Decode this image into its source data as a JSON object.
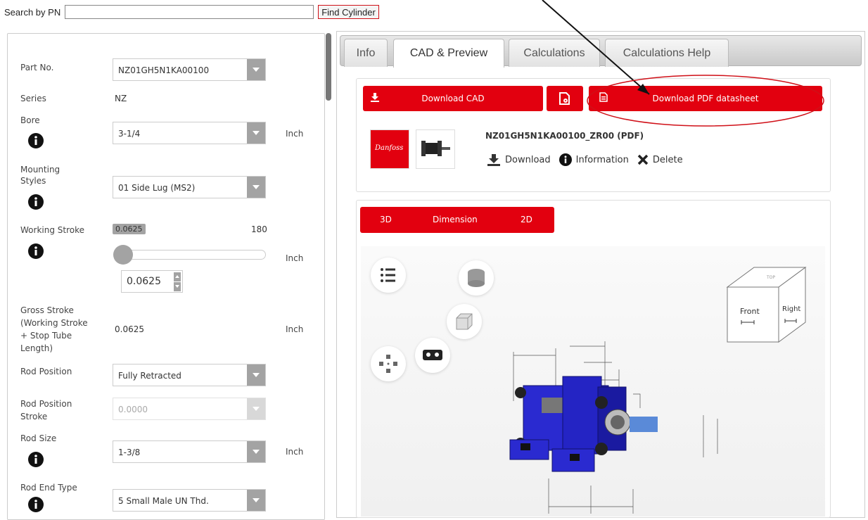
{
  "search": {
    "label": "Search by PN",
    "value": "",
    "placeholder": "",
    "button": "Find Cylinder"
  },
  "form": {
    "part_no": {
      "label": "Part No.",
      "value": "NZ01GH5N1KA00100"
    },
    "series": {
      "label": "Series",
      "value": "NZ"
    },
    "bore": {
      "label": "Bore",
      "value": "3-1/4",
      "unit": "Inch"
    },
    "mounting": {
      "label_line1": "Mounting",
      "label_line2": "Styles",
      "value": "01 Side Lug (MS2)"
    },
    "working_stroke": {
      "label": "Working Stroke",
      "min": "0.0625",
      "max": "180",
      "value": "0.0625",
      "unit": "Inch",
      "slider_fraction": 0.0
    },
    "gross_stroke": {
      "label_lines": [
        "Gross Stroke",
        "(Working Stroke",
        "+ Stop Tube",
        "Length)"
      ],
      "value": "0.0625",
      "unit": "Inch"
    },
    "rod_position": {
      "label": "Rod Position",
      "value": "Fully Retracted"
    },
    "rod_position_stroke": {
      "label_line1": "Rod Position",
      "label_line2": "Stroke",
      "value": "0.0000"
    },
    "rod_size": {
      "label": "Rod Size",
      "value": "1-3/8",
      "unit": "Inch"
    },
    "rod_end_type": {
      "label": "Rod End Type",
      "value": "5 Small Male UN Thd."
    }
  },
  "tabs": [
    {
      "label": "Info",
      "active": false
    },
    {
      "label": "CAD & Preview",
      "active": true
    },
    {
      "label": "Calculations",
      "active": false
    },
    {
      "label": "Calculations Help",
      "active": false
    }
  ],
  "cad": {
    "download_cad": "Download CAD",
    "download_pdf": "Download PDF datasheet",
    "file_title": "NZ01GH5N1KA00100_ZR00 (PDF)",
    "actions": {
      "download": "Download",
      "information": "Information",
      "delete": "Delete"
    },
    "logo_text": "Danfoss"
  },
  "viewer": {
    "tabs": [
      "3D",
      "Dimension",
      "2D"
    ],
    "cube_labels": {
      "front": "Front",
      "right": "Right",
      "top": "TOP"
    }
  },
  "colors": {
    "accent": "#e2000f",
    "gray_control": "#a3a3a3",
    "cylinder_blue": "#2a2ad0"
  }
}
